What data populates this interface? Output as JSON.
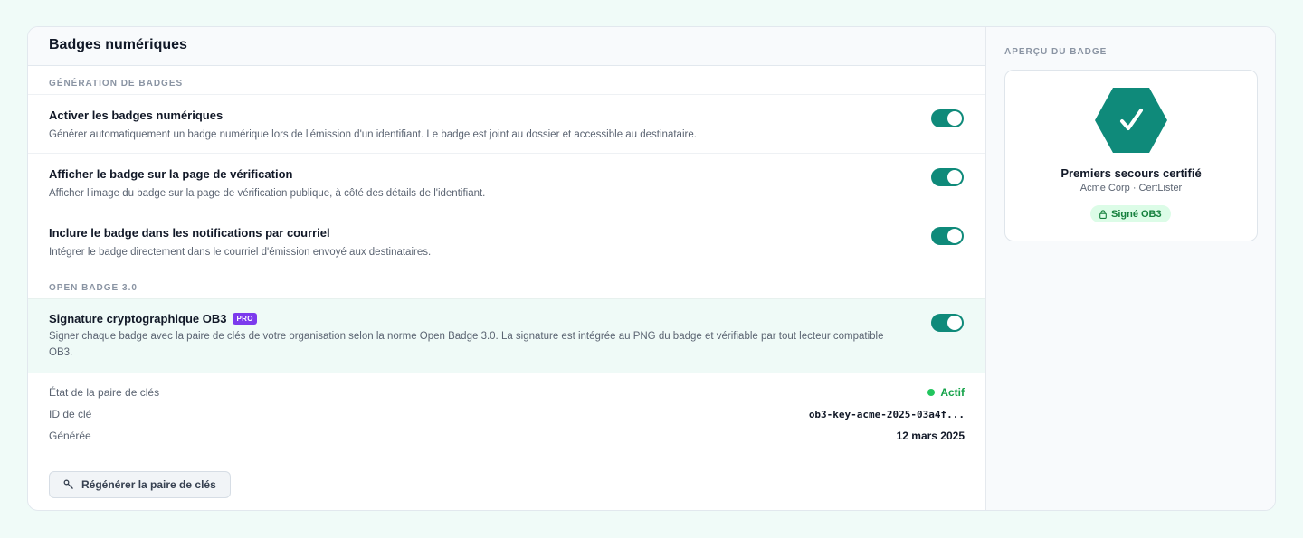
{
  "header": {
    "title": "Badges numériques"
  },
  "sections": {
    "generation": "GÉNÉRATION DE BADGES",
    "openbadge": "OPEN BADGE 3.0"
  },
  "settings": [
    {
      "title": "Activer les badges numériques",
      "description": "Générer automatiquement un badge numérique lors de l'émission d'un identifiant. Le badge est joint au dossier et accessible au destinataire.",
      "enabled": true
    },
    {
      "title": "Afficher le badge sur la page de vérification",
      "description": "Afficher l'image du badge sur la page de vérification publique, à côté des détails de l'identifiant.",
      "enabled": true
    },
    {
      "title": "Inclure le badge dans les notifications par courriel",
      "description": "Intégrer le badge directement dans le courriel d'émission envoyé aux destinataires.",
      "enabled": true
    },
    {
      "title": "Signature cryptographique OB3",
      "tag": "PRO",
      "description": "Signer chaque badge avec la paire de clés de votre organisation selon la norme Open Badge 3.0. La signature est intégrée au PNG du badge et vérifiable par tout lecteur compatible OB3.",
      "enabled": true
    }
  ],
  "keypair": {
    "status_label": "État de la paire de clés",
    "status_value": "Actif",
    "id_label": "ID de clé",
    "id_value": "ob3-key-acme-2025-03a4f...",
    "generated_label": "Générée",
    "generated_value": "12 mars 2025",
    "regen_label": "Régénérer la paire de clés",
    "regen_icon": "key-icon"
  },
  "preview": {
    "label": "APERÇU DU BADGE",
    "badge_icon": "checkmark-icon",
    "badge_name": "Premiers secours certifié",
    "badge_org": "Acme Corp · CertLister",
    "signed_label": "Signé OB3",
    "signed_icon": "lock-icon"
  },
  "colors": {
    "accent": "#0f8a7a",
    "pro_tag": "#7c3aed",
    "status_active": "#22c55e"
  }
}
